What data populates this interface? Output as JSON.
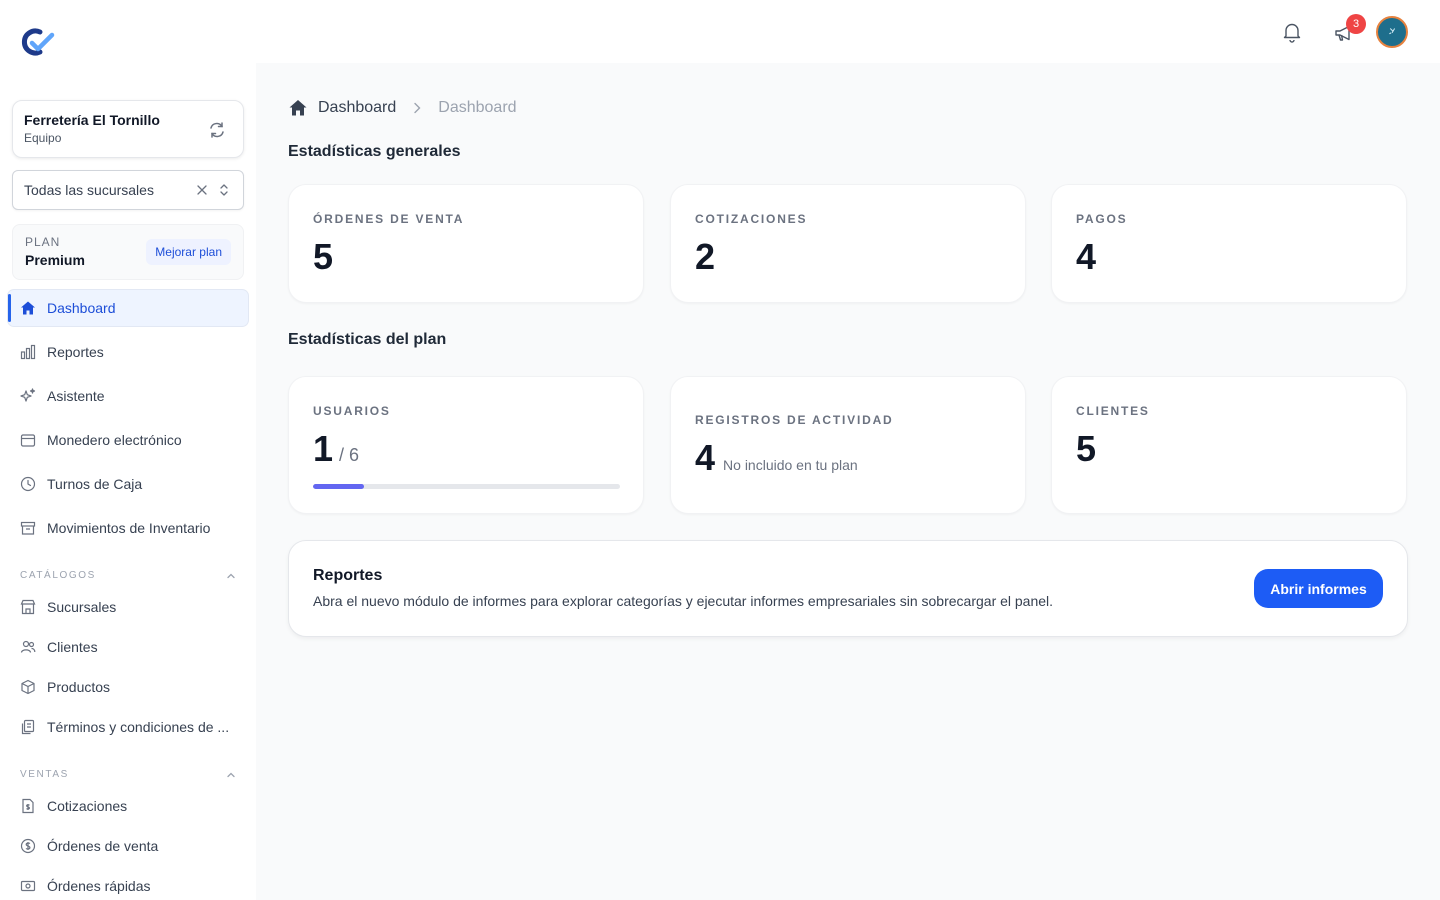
{
  "sidebar": {
    "org": {
      "name": "Ferretería El Tornillo",
      "subtitle": "Equipo"
    },
    "branch_select": {
      "value": "Todas las sucursales"
    },
    "plan": {
      "label": "PLAN",
      "name": "Premium",
      "upgrade_label": "Mejorar plan"
    },
    "nav": [
      {
        "label": "Dashboard",
        "icon": "home-icon",
        "active": true
      },
      {
        "label": "Reportes",
        "icon": "bar-chart-icon"
      },
      {
        "label": "Asistente",
        "icon": "sparkles-icon"
      },
      {
        "label": "Monedero electrónico",
        "icon": "wallet-icon"
      },
      {
        "label": "Turnos de Caja",
        "icon": "clock-icon"
      },
      {
        "label": "Movimientos de Inventario",
        "icon": "archive-icon"
      }
    ],
    "catalogos": {
      "heading": "CATÁLOGOS",
      "items": [
        {
          "label": "Sucursales",
          "icon": "store-icon"
        },
        {
          "label": "Clientes",
          "icon": "users-icon"
        },
        {
          "label": "Productos",
          "icon": "cube-icon"
        },
        {
          "label": "Términos y condiciones de ...",
          "icon": "documents-icon"
        }
      ]
    },
    "ventas": {
      "heading": "VENTAS",
      "items": [
        {
          "label": "Cotizaciones",
          "icon": "document-dollar-icon"
        },
        {
          "label": "Órdenes de venta",
          "icon": "currency-dollar-icon"
        },
        {
          "label": "Órdenes rápidas",
          "icon": "cash-icon"
        }
      ]
    }
  },
  "topbar": {
    "announcement_badge": "3"
  },
  "breadcrumb": {
    "first": "Dashboard",
    "second": "Dashboard"
  },
  "general_stats": {
    "title": "Estadísticas generales",
    "cards": [
      {
        "label": "ÓRDENES DE VENTA",
        "value": "5"
      },
      {
        "label": "COTIZACIONES",
        "value": "2"
      },
      {
        "label": "PAGOS",
        "value": "4"
      }
    ]
  },
  "plan_stats": {
    "title": "Estadísticas del plan",
    "users": {
      "label": "USUARIOS",
      "value": "1",
      "limit": "/ 6",
      "progress": 0.1667
    },
    "activity": {
      "label": "REGISTROS DE ACTIVIDAD",
      "value": "4",
      "note": "No incluido en tu plan"
    },
    "clients": {
      "label": "CLIENTES",
      "value": "5"
    }
  },
  "reports": {
    "title": "Reportes",
    "description": "Abra el nuevo módulo de informes para explorar categorías y ejecutar informes empresariales sin sobrecargar el panel.",
    "button": "Abrir informes"
  },
  "colors": {
    "primary": "#1d5cf5",
    "active_bg": "#eef4ff",
    "badge": "#ef4444",
    "progress": "#6366f1"
  }
}
